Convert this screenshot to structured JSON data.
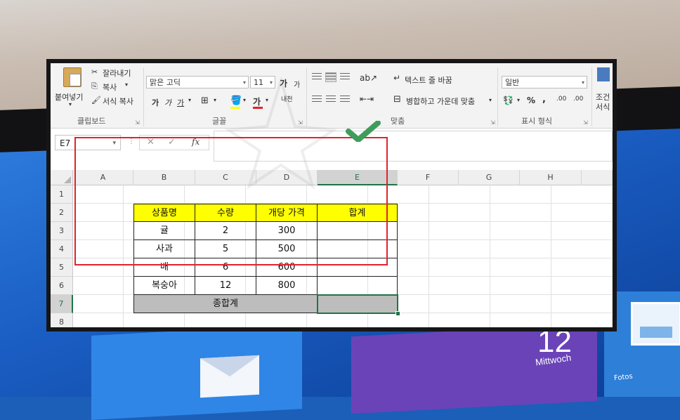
{
  "ribbon": {
    "clipboard": {
      "paste": "붙여넣기",
      "cut": "잘라내기",
      "copy": "복사",
      "format_painter": "서식 복사",
      "group": "클립보드"
    },
    "font": {
      "name": "맑은 고딕",
      "size": "11",
      "grow": "가",
      "shrink": "가",
      "bold": "가",
      "italic": "가",
      "underline": "가",
      "font_color": "가",
      "phonetic": "내천",
      "group": "글꼴"
    },
    "alignment": {
      "wrap_text": "텍스트 줄 바꿈",
      "merge_center": "병합하고 가운데 맞춤",
      "group": "맞춤"
    },
    "number": {
      "format": "일반",
      "percent": "%",
      "comma": ",",
      "inc_decimal": ".00",
      "dec_decimal": ".00",
      "group": "표시 형식"
    },
    "styles": {
      "conditional_line1": "조건",
      "conditional_line2": "서식"
    }
  },
  "formula_bar": {
    "name_box": "E7",
    "fx": "fx",
    "value": ""
  },
  "columns": [
    "A",
    "B",
    "C",
    "D",
    "E",
    "F",
    "G",
    "H"
  ],
  "rows": [
    "1",
    "2",
    "3",
    "4",
    "5",
    "6",
    "7",
    "8"
  ],
  "table": {
    "headers": [
      "상품명",
      "수량",
      "개당 가격",
      "합계"
    ],
    "items": [
      {
        "name": "귤",
        "qty": "2",
        "price": "300",
        "total": ""
      },
      {
        "name": "사과",
        "qty": "5",
        "price": "500",
        "total": ""
      },
      {
        "name": "배",
        "qty": "6",
        "price": "600",
        "total": ""
      },
      {
        "name": "복숭아",
        "qty": "12",
        "price": "800",
        "total": ""
      }
    ],
    "grand_total_label": "종합계",
    "grand_total_value": ""
  },
  "desktop": {
    "date_number": "12",
    "date_day": "Mittwoch",
    "photos_label": "Fotos"
  },
  "colors": {
    "header_fill": "#ffff00",
    "total_fill": "#bdbdbd",
    "highlight_box": "#e0242a",
    "check": "#3f9c5c",
    "excel_green": "#217346"
  }
}
